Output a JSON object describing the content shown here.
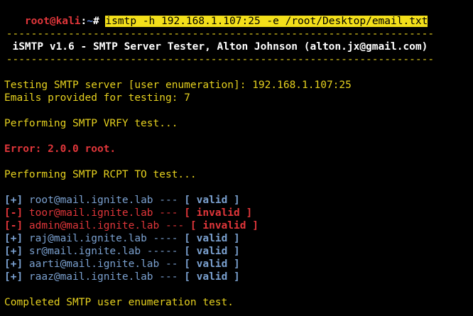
{
  "prompt": {
    "user_host": "root@kali",
    "separator": ":",
    "path": "~",
    "symbol": "# ",
    "command": "ismtp -h 192.168.1.107:25 -e /root/Desktop/email.txt"
  },
  "banner": {
    "rule_top": " ---------------------------------------------------------------------",
    "title": "  iSMTP v1.6 - SMTP Server Tester, Alton Johnson (alton.jx@gmail.com)",
    "rule_bottom": " ---------------------------------------------------------------------"
  },
  "output": {
    "testing_line": "Testing SMTP server [user enumeration]: 192.168.1.107:25",
    "emails_line": "Emails provided for testing: 7",
    "vrfy_line": "Performing SMTP VRFY test...",
    "error_line": "Error: 2.0.0 root.",
    "rcpt_line": "Performing SMTP RCPT TO test...",
    "completed_line": "Completed SMTP user enumeration test."
  },
  "results": [
    {
      "marker": "[+]",
      "text": " root@mail.ignite.lab --- ",
      "status": "[ valid ]",
      "valid": true
    },
    {
      "marker": "[-]",
      "text": " toor@mail.ignite.lab --- ",
      "status": "[ invalid ]",
      "valid": false
    },
    {
      "marker": "[-]",
      "text": " admin@mail.ignite.lab --- ",
      "status": "[ invalid ]",
      "valid": false
    },
    {
      "marker": "[+]",
      "text": " raj@mail.ignite.lab ---- ",
      "status": "[ valid ]",
      "valid": true
    },
    {
      "marker": "[+]",
      "text": " sr@mail.ignite.lab ----- ",
      "status": "[ valid ]",
      "valid": true
    },
    {
      "marker": "[+]",
      "text": " aarti@mail.ignite.lab -- ",
      "status": "[ valid ]",
      "valid": true
    },
    {
      "marker": "[+]",
      "text": " raaz@mail.ignite.lab --- ",
      "status": "[ valid ]",
      "valid": true
    }
  ],
  "colors": {
    "background": "#000000",
    "prompt_user": "#e0363a",
    "prompt_path": "#5f87d7",
    "command_highlight": "#f3df1a",
    "info_text": "#e6d11f",
    "error_text": "#e0363a",
    "valid_text": "#7aa0cf",
    "invalid_text": "#e0363a"
  }
}
